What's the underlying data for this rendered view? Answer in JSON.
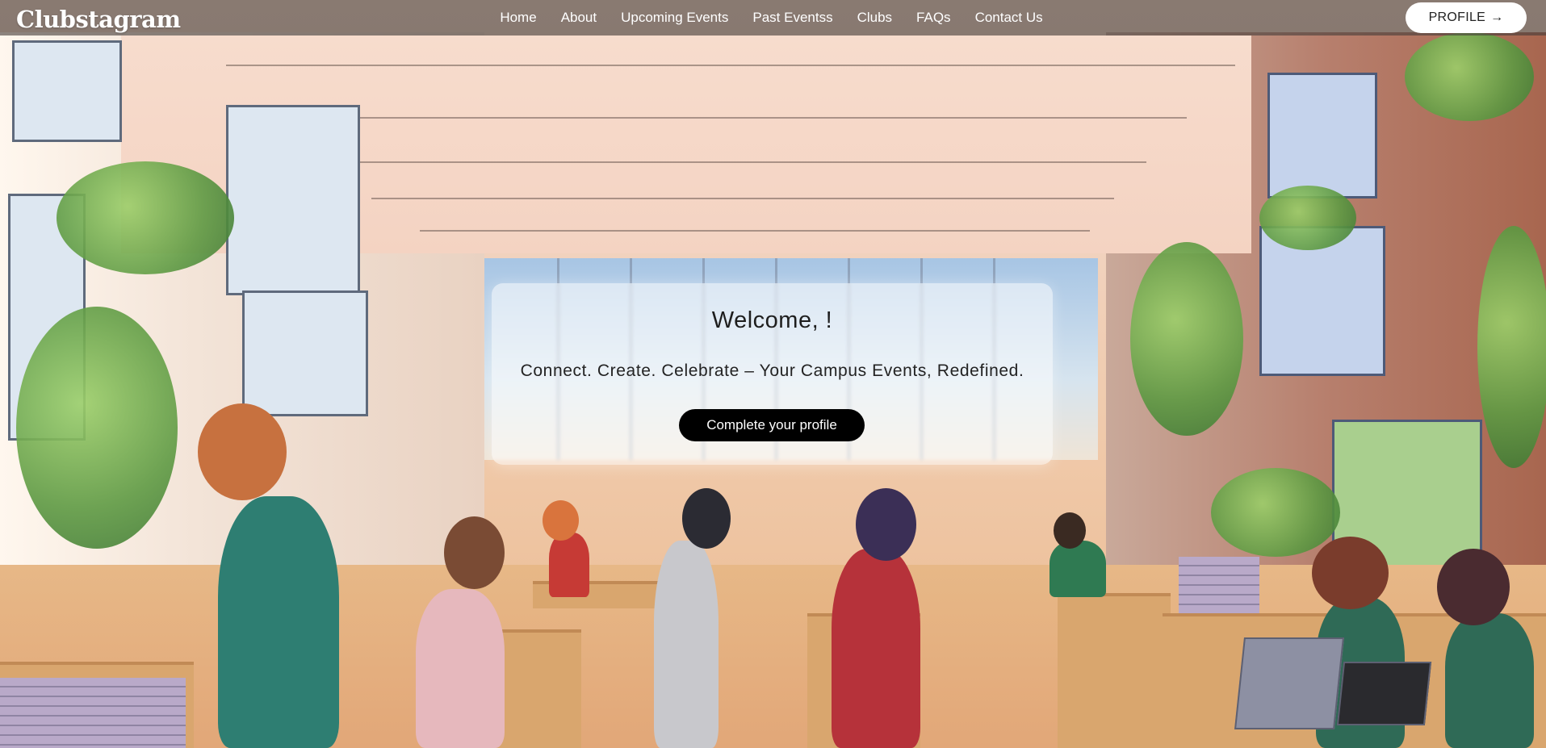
{
  "brand": {
    "name": "Clubstagram"
  },
  "nav": {
    "items": [
      {
        "label": "Home"
      },
      {
        "label": "About"
      },
      {
        "label": "Upcoming Events"
      },
      {
        "label": "Past Eventss"
      },
      {
        "label": "Clubs"
      },
      {
        "label": "FAQs"
      },
      {
        "label": "Contact Us"
      }
    ]
  },
  "profile_button": {
    "label": "PROFILE",
    "arrow": "→"
  },
  "welcome": {
    "title": "Welcome, !",
    "subtitle": "Connect. Create. Celebrate – Your Campus Events, Redefined.",
    "cta_label": "Complete your profile"
  },
  "colors": {
    "navbar_bg": "#463e3a",
    "cta_bg": "#000000",
    "profile_bg": "#ffffff"
  }
}
